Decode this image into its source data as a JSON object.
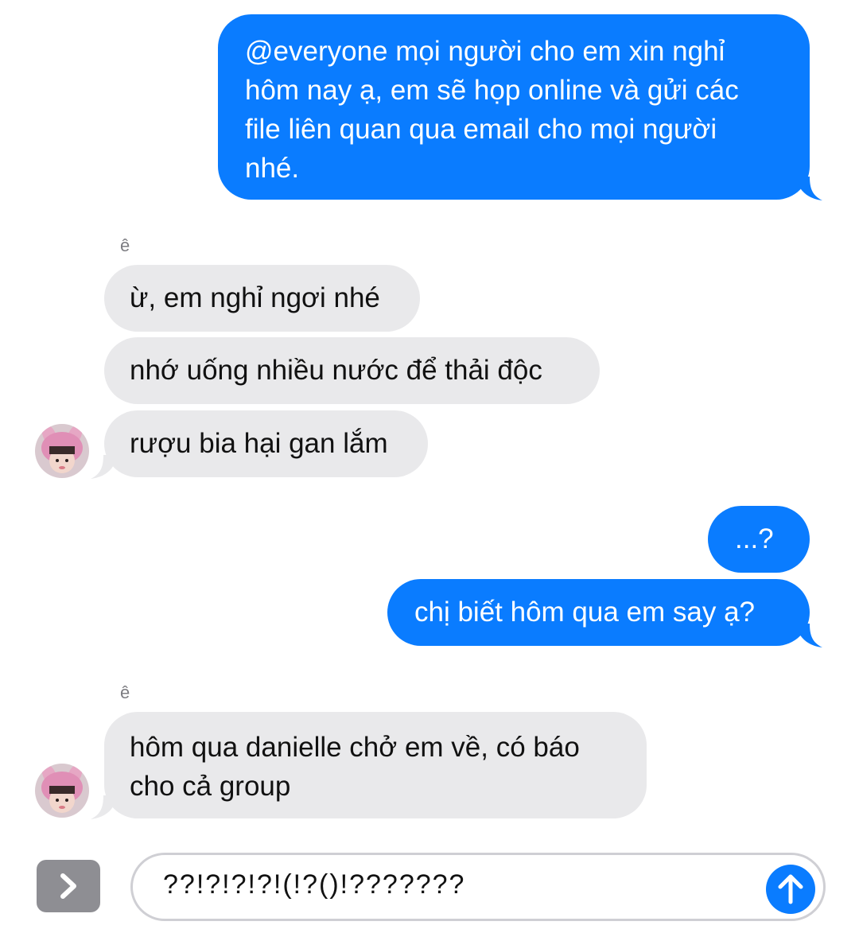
{
  "conversation": {
    "colors": {
      "outgoing_bubble": "#0a7cff",
      "incoming_bubble": "#e9e9eb",
      "outgoing_text": "#ffffff",
      "incoming_text": "#111111"
    },
    "messages": [
      {
        "direction": "out",
        "lines": [
          "@everyone mọi người cho em xin nghỉ",
          "hôm nay ạ, em sẽ họp online và gửi các",
          "file liên quan qua email cho mọi người",
          "nhé."
        ]
      },
      {
        "direction": "in",
        "sender": "ê",
        "messages": [
          "ừ, em nghỉ ngơi nhé",
          "nhớ uống nhiều nước để thải độc",
          "rượu bia hại gan lắm"
        ]
      },
      {
        "direction": "out",
        "messages": [
          "...?",
          "chị biết hôm qua em say ạ?"
        ]
      },
      {
        "direction": "in",
        "sender": "ê",
        "lines": [
          "hôm qua danielle chở em về, có báo",
          "cho cả group"
        ]
      }
    ]
  },
  "composer": {
    "text": "??!?!?!?!(!?()!???????",
    "toggle_icon": "chevron-right-icon",
    "send_icon": "arrow-up-icon"
  }
}
